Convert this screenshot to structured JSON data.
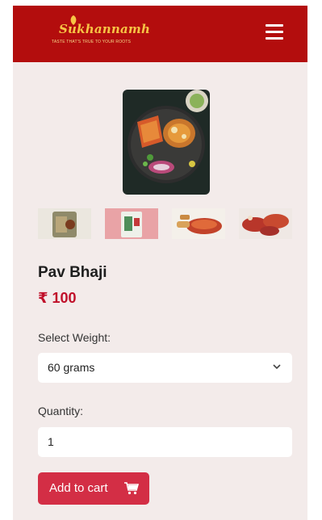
{
  "header": {
    "logo_name": "Sukhannamh",
    "logo_tagline": "TASTE THAT'S TRUE TO YOUR ROOTS",
    "menu_icon": "hamburger-menu-icon",
    "bg_color": "#b30d0d"
  },
  "gallery": {
    "main_image": "pav-bhaji-plate",
    "thumbnails": [
      "product-pack-thumb",
      "product-pack-pink-thumb",
      "pav-bhaji-dish-thumb",
      "pav-bhaji-spread-thumb"
    ]
  },
  "product": {
    "title": "Pav Bhaji",
    "price": "₹ 100",
    "price_color": "#c0102a"
  },
  "weight": {
    "label": "Select Weight:",
    "selected": "60 grams"
  },
  "quantity": {
    "label": "Quantity:",
    "value": "1"
  },
  "cart": {
    "button_label": "Add to cart",
    "icon": "shopping-cart-icon",
    "color": "#d32e45"
  }
}
